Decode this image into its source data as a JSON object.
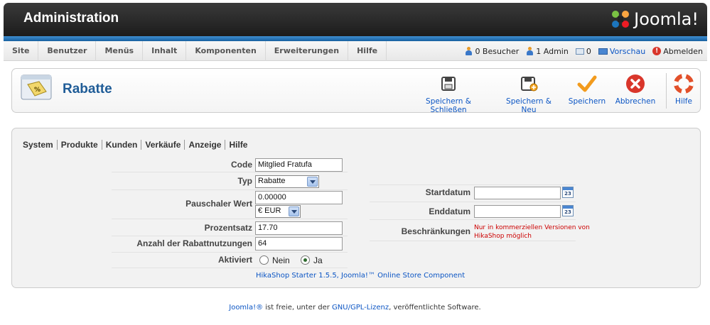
{
  "header": {
    "title": "Administration",
    "logo_text": "Joomla!"
  },
  "menu": {
    "items": [
      "Site",
      "Benutzer",
      "Menüs",
      "Inhalt",
      "Komponenten",
      "Erweiterungen",
      "Hilfe"
    ]
  },
  "status": {
    "visitors": "0 Besucher",
    "admins": "1 Admin",
    "messages": "0",
    "preview": "Vorschau",
    "logout": "Abmelden"
  },
  "toolbar": {
    "page_title": "Rabatte",
    "save_close": "Speichern & Schließen",
    "save_new": "Speichern & Neu",
    "save": "Speichern",
    "cancel": "Abbrechen",
    "help": "Hilfe"
  },
  "tabs": [
    "System",
    "Produkte",
    "Kunden",
    "Verkäufe",
    "Anzeige",
    "Hilfe"
  ],
  "form": {
    "code_label": "Code",
    "code_value": "Mitglied Fratufa",
    "type_label": "Typ",
    "type_value": "Rabatte",
    "flat_label": "Pauschaler Wert",
    "flat_value": "0.00000",
    "currency_value": "€ EUR",
    "percent_label": "Prozentsatz",
    "percent_value": "17.70",
    "uses_label": "Anzahl der Rabattnutzungen",
    "uses_value": "64",
    "active_label": "Aktiviert",
    "active_no": "Nein",
    "active_yes": "Ja",
    "active_selected": "Ja",
    "start_label": "Startdatum",
    "start_value": "",
    "end_label": "Enddatum",
    "end_value": "",
    "restrictions_label": "Beschränkungen",
    "restrictions_note_1": "Nur in kommerziellen Versionen von",
    "restrictions_note_2": "HikaShop möglich",
    "calendar_day": "23",
    "hikashop_credit": "HikaShop Starter 1.5.5, Joomla!™ Online Store Component"
  },
  "footer": {
    "joomla_link": "Joomla!®",
    "text_1": " ist freie, unter der ",
    "license_link": "GNU/GPL-Lizenz",
    "text_2": ", veröffentlichte Software."
  }
}
